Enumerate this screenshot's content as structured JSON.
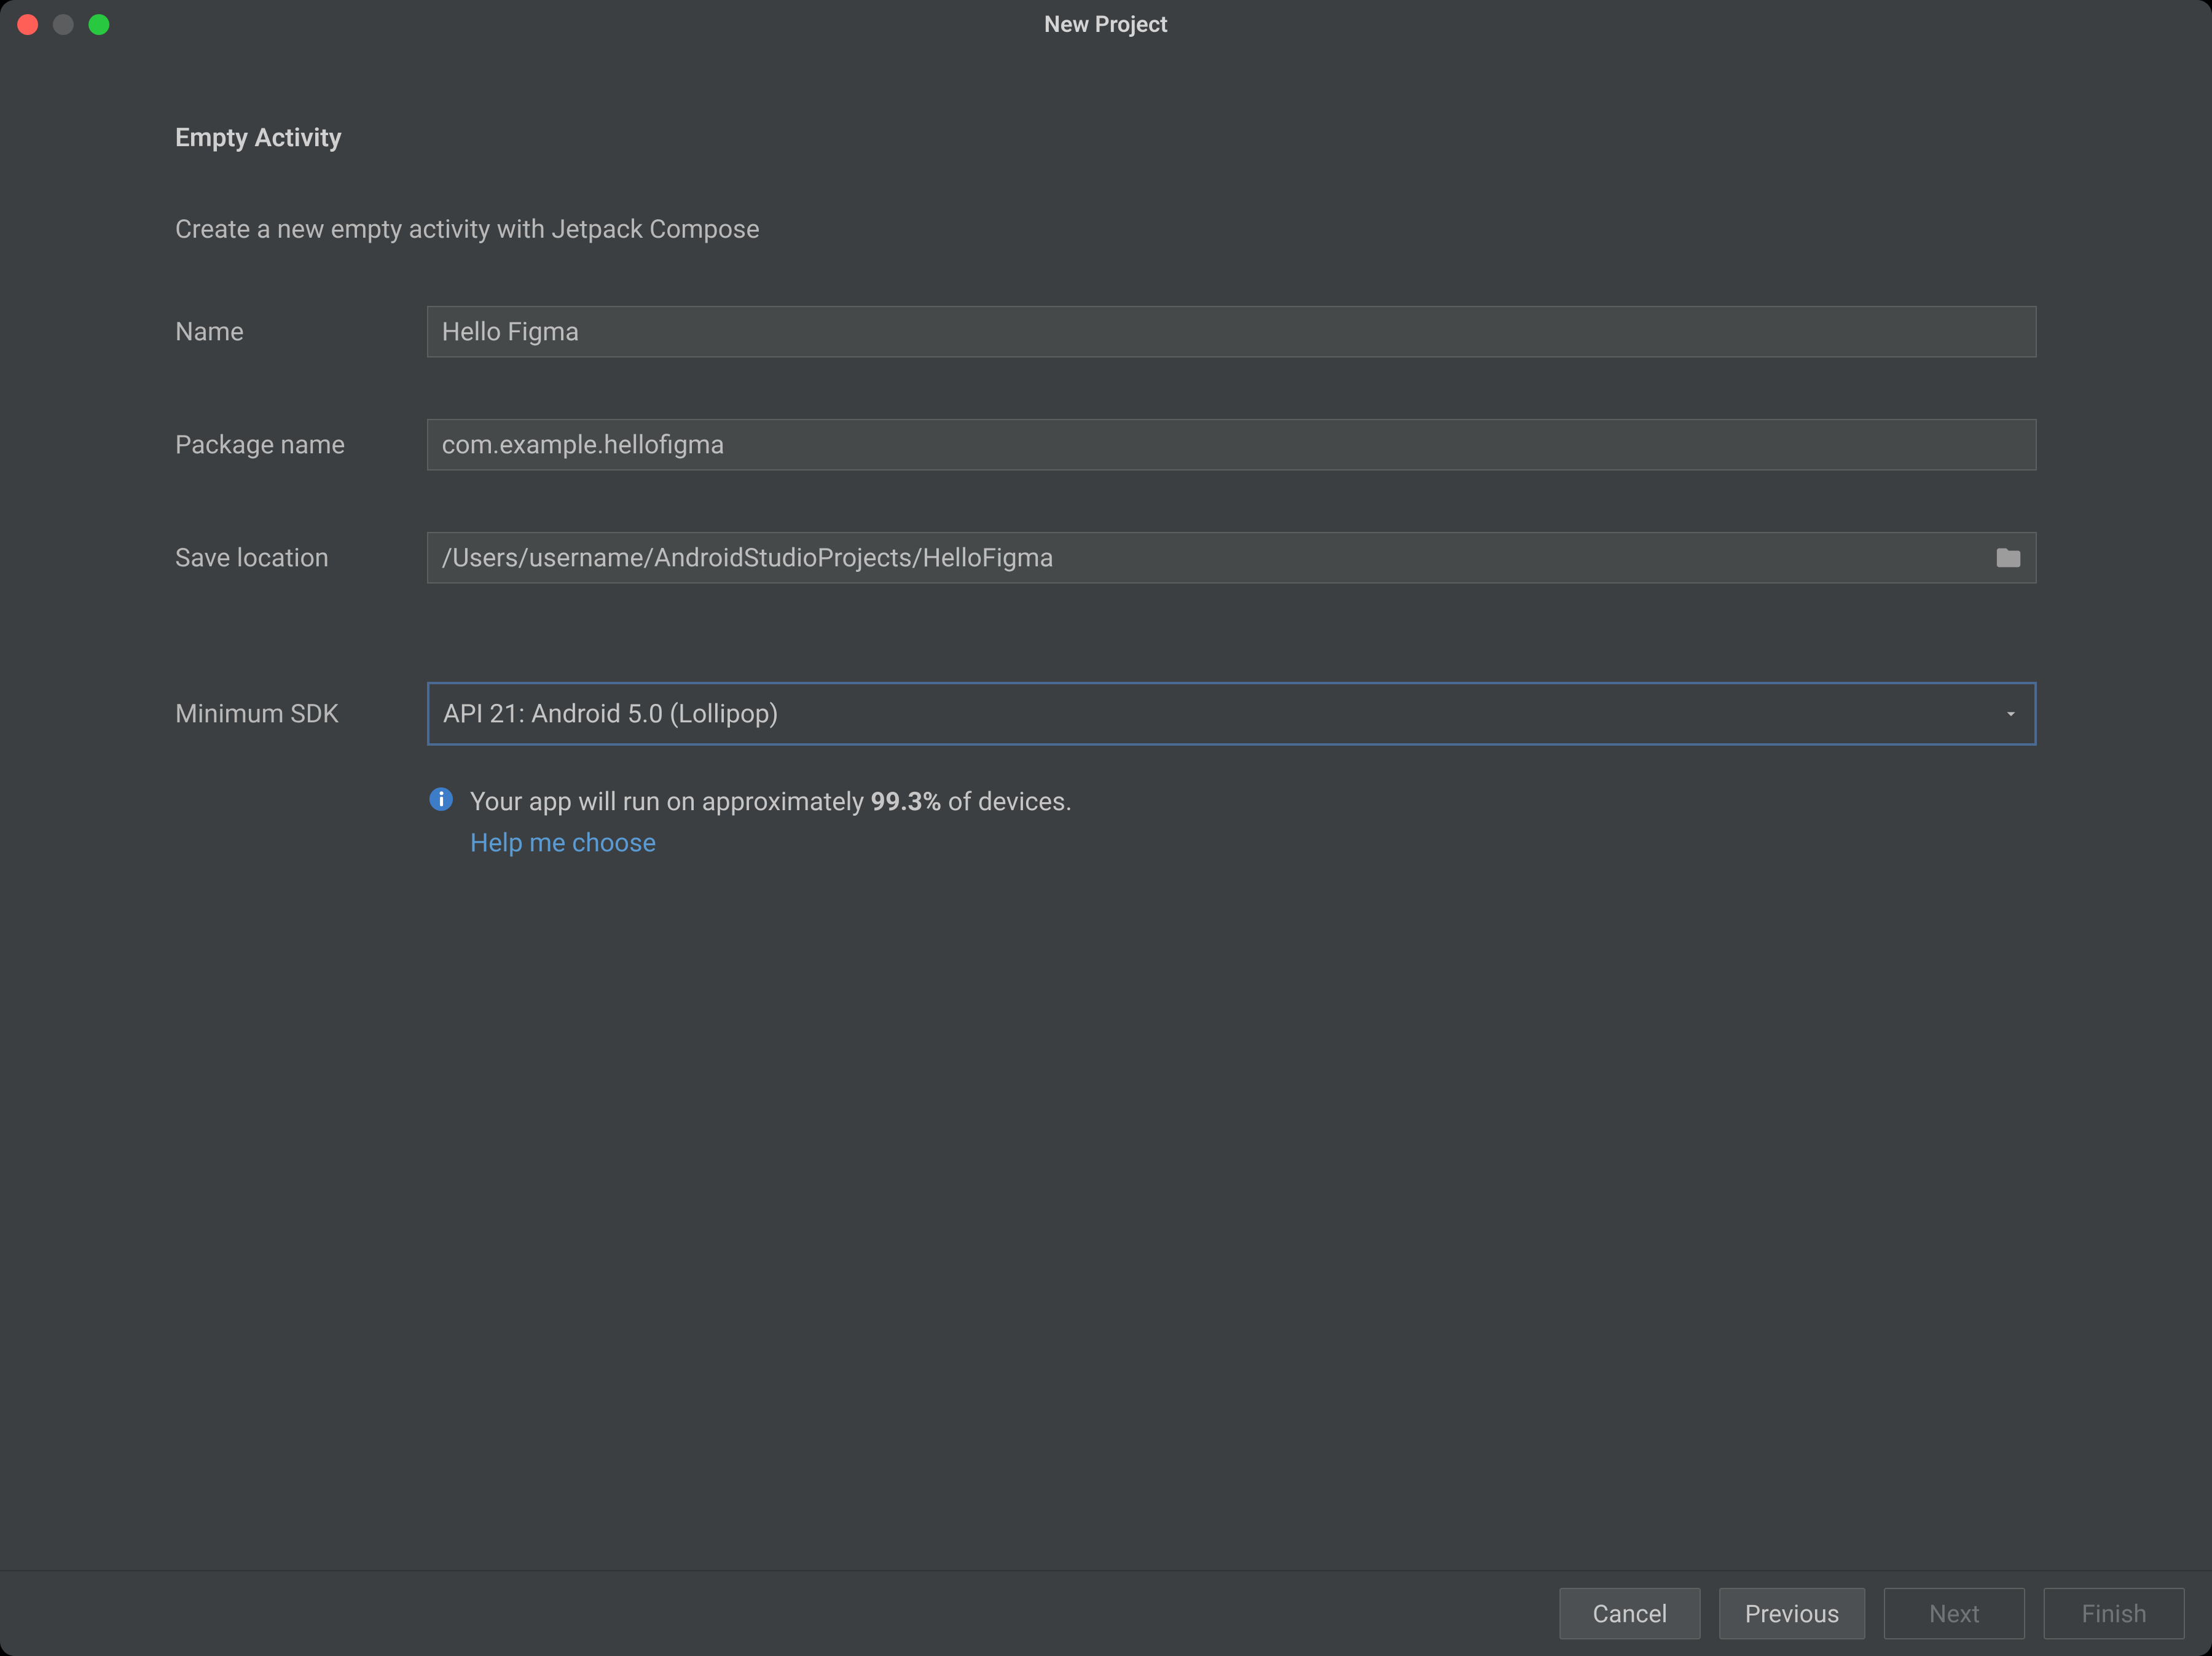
{
  "window": {
    "title": "New Project"
  },
  "page": {
    "heading": "Empty Activity",
    "subtext": "Create a new empty activity with Jetpack Compose"
  },
  "form": {
    "name_label": "Name",
    "name_value": "Hello Figma",
    "package_label": "Package name",
    "package_value": "com.example.hellofigma",
    "location_label": "Save location",
    "location_value": "/Users/username/AndroidStudioProjects/HelloFigma",
    "sdk_label": "Minimum SDK",
    "sdk_value": "API 21: Android 5.0 (Lollipop)"
  },
  "info": {
    "prefix": "Your app will run on approximately ",
    "percent": "99.3%",
    "suffix": " of devices.",
    "help_link": "Help me choose"
  },
  "footer": {
    "cancel": "Cancel",
    "previous": "Previous",
    "next": "Next",
    "finish": "Finish"
  }
}
